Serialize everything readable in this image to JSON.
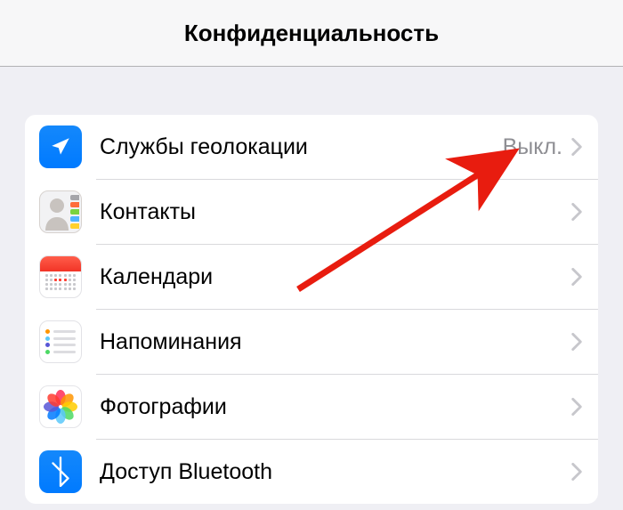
{
  "header": {
    "title": "Конфиденциальность"
  },
  "rows": {
    "location": {
      "label": "Службы геолокации",
      "value": "Выкл."
    },
    "contacts": {
      "label": "Контакты"
    },
    "calendar": {
      "label": "Календари"
    },
    "reminders": {
      "label": "Напоминания"
    },
    "photos": {
      "label": "Фотографии"
    },
    "bluetooth": {
      "label": "Доступ Bluetooth"
    }
  }
}
